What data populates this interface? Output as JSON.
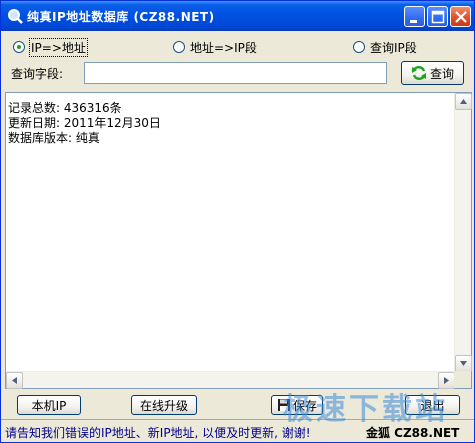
{
  "window": {
    "title": "纯真IP地址数据库  (CZ88.NET)"
  },
  "mode_options": [
    {
      "label": "IP=>地址",
      "checked": true
    },
    {
      "label": "地址=>IP段",
      "checked": false
    },
    {
      "label": "查询IP段",
      "checked": false
    }
  ],
  "query": {
    "label": "查询字段:",
    "value": "",
    "button_label": "查询"
  },
  "output": {
    "text": "记录总数: 436316条\n更新日期: 2011年12月30日\n数据库版本: 纯真"
  },
  "buttons": {
    "local_ip": "本机IP",
    "online_upgrade": "在线升级",
    "save": "保存",
    "exit": "退出"
  },
  "status": {
    "message": "请告知我们错误的IP地址、新IP地址, 以便及时更新, 谢谢!",
    "brand": "金狐 CZ88.NET"
  },
  "watermark": {
    "text": "极速下载站"
  },
  "colors": {
    "titlebar": "#0050e0",
    "status_text": "#00008b",
    "refresh_icon": "#21a121"
  }
}
